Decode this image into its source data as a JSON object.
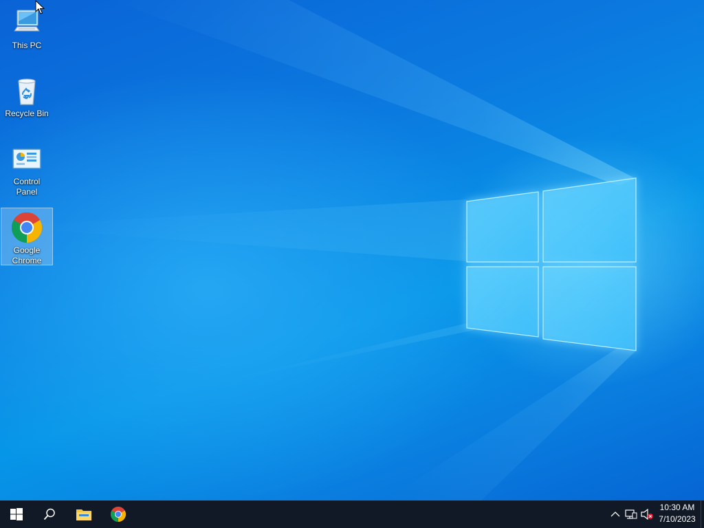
{
  "desktop": {
    "icons": [
      {
        "label": "This PC",
        "icon": "this-pc-icon"
      },
      {
        "label": "Recycle Bin",
        "icon": "recycle-bin-icon"
      },
      {
        "label": "Control Panel",
        "icon": "control-panel-icon"
      },
      {
        "label": "Google Chrome",
        "icon": "chrome-icon",
        "selected": true
      }
    ]
  },
  "taskbar": {
    "start": {
      "icon": "windows-start-icon"
    },
    "search": {
      "icon": "search-icon"
    },
    "pinned": [
      {
        "app": "File Explorer",
        "icon": "file-explorer-icon"
      },
      {
        "app": "Google Chrome",
        "icon": "chrome-icon"
      }
    ],
    "tray": {
      "icons": [
        "chevron-up-icon",
        "network-icon",
        "volume-muted-icon"
      ]
    },
    "clock": {
      "time": "10:30 AM",
      "date": "7/10/2023"
    }
  },
  "colors": {
    "desktop_blue": "#0a7fe0",
    "taskbar_bg": "#101925",
    "selection": "#b4d7f5"
  }
}
